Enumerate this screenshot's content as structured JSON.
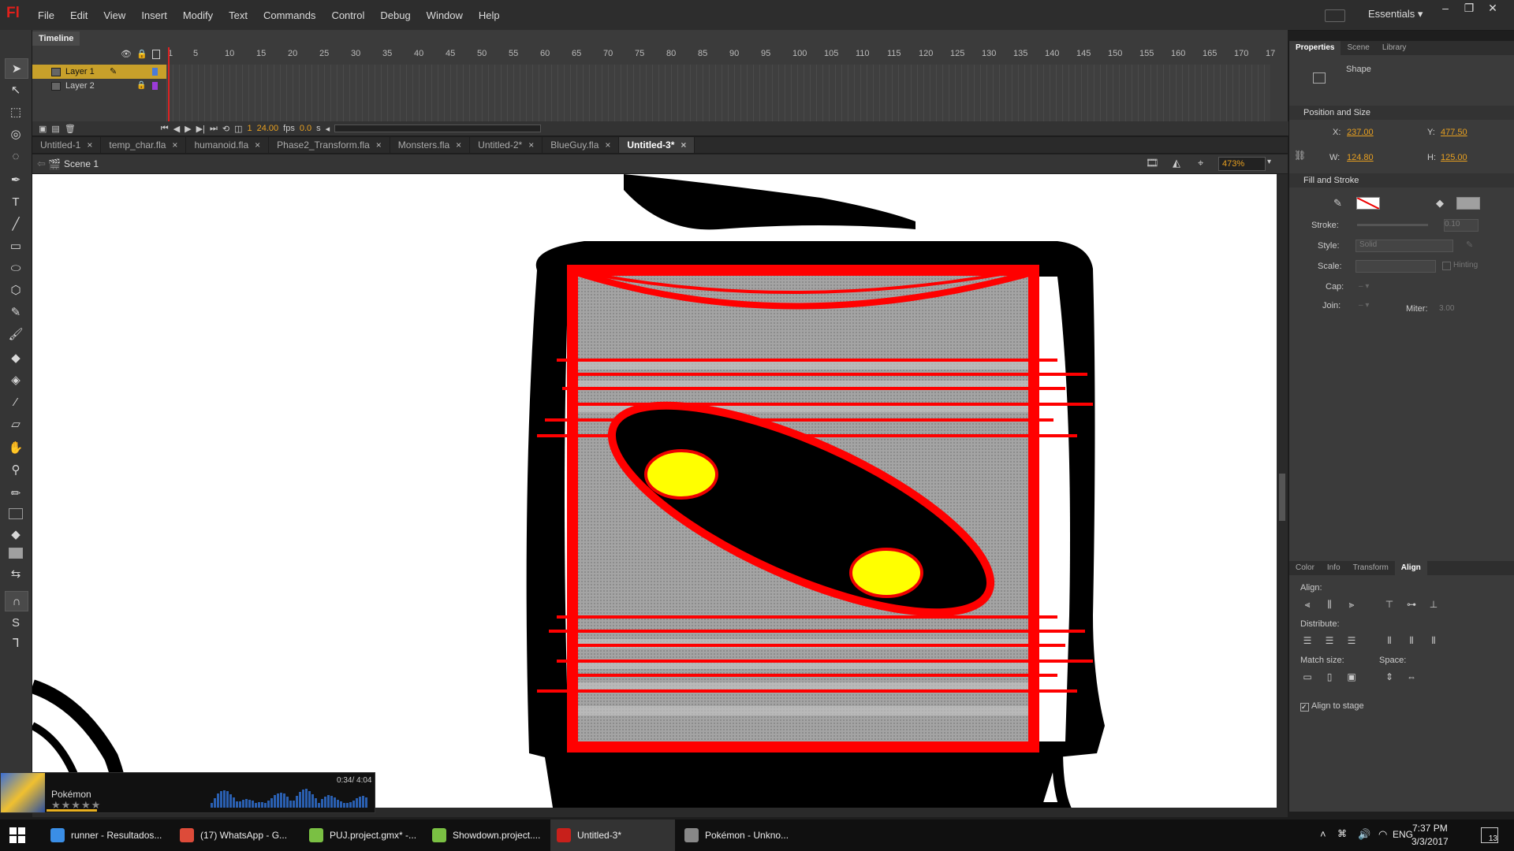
{
  "app": {
    "logo_text": "Fl",
    "menu": [
      "File",
      "Edit",
      "View",
      "Insert",
      "Modify",
      "Text",
      "Commands",
      "Control",
      "Debug",
      "Window",
      "Help"
    ],
    "workspace": "Essentials",
    "window_controls": [
      "minimize-icon",
      "restore-icon",
      "close-icon"
    ]
  },
  "timeline": {
    "tab": "Timeline",
    "ruler": [
      "1",
      "5",
      "10",
      "15",
      "20",
      "25",
      "30",
      "35",
      "40",
      "45",
      "50",
      "55",
      "60",
      "65",
      "70",
      "75",
      "80",
      "85",
      "90",
      "95",
      "100",
      "105",
      "110",
      "115",
      "120",
      "125",
      "130",
      "135",
      "140",
      "145",
      "150",
      "155",
      "160",
      "165",
      "170",
      "17"
    ],
    "layers": [
      {
        "name": "Layer 1",
        "color": "#4a7bd8",
        "selected": true
      },
      {
        "name": "Layer 2",
        "color": "#9b3bd8",
        "selected": false
      }
    ],
    "frame": "1",
    "fps": "24.00",
    "fps_unit": "fps",
    "time": "0.0",
    "time_unit": "s"
  },
  "doc_tabs": [
    {
      "label": "Untitled-1",
      "active": false
    },
    {
      "label": "temp_char.fla",
      "active": false
    },
    {
      "label": "humanoid.fla",
      "active": false
    },
    {
      "label": "Phase2_Transform.fla",
      "active": false
    },
    {
      "label": "Monsters.fla",
      "active": false
    },
    {
      "label": "Untitled-2*",
      "active": false
    },
    {
      "label": "BlueGuy.fla",
      "active": false
    },
    {
      "label": "Untitled-3*",
      "active": true
    }
  ],
  "editbar": {
    "scene": "Scene 1",
    "zoom": "473%"
  },
  "properties": {
    "tabs": [
      "Properties",
      "Scene",
      "Library"
    ],
    "object_type": "Shape",
    "position_size": {
      "header": "Position and Size",
      "x_label": "X:",
      "x": "237.00",
      "y_label": "Y:",
      "y": "477.50",
      "w_label": "W:",
      "w": "124.80",
      "h_label": "H:",
      "h": "125.00"
    },
    "fill_stroke": {
      "header": "Fill and Stroke",
      "stroke_label": "Stroke:",
      "stroke_value": "0.10",
      "style_label": "Style:",
      "style_value": "Solid",
      "scale_label": "Scale:",
      "hinting": "Hinting",
      "cap_label": "Cap:",
      "join_label": "Join:",
      "miter_label": "Miter:",
      "miter_value": "3.00",
      "fill_color": "#a0a0a0"
    }
  },
  "align_panel": {
    "tabs": [
      "Color",
      "Info",
      "Transform",
      "Align"
    ],
    "align_label": "Align:",
    "distribute_label": "Distribute:",
    "match_label": "Match size:",
    "space_label": "Space:",
    "align_to_stage": "Align to stage"
  },
  "music": {
    "title": "Pokémon",
    "time": "0:34/ 4:04",
    "rating": "★★★★★"
  },
  "taskbar": {
    "tasks": [
      {
        "label": "runner - Resultados...",
        "color": "#3a8ee6"
      },
      {
        "label": "(17) WhatsApp - G...",
        "color": "#dd4b39"
      },
      {
        "label": "PUJ.project.gmx* -...",
        "color": "#7ac043"
      },
      {
        "label": "Showdown.project....",
        "color": "#7ac043"
      },
      {
        "label": "Untitled-3*",
        "color": "#c8201b"
      },
      {
        "label": "Pokémon - Unkno...",
        "color": "#888888"
      }
    ],
    "lang": "ENG",
    "time": "7:37 PM",
    "date": "3/3/2017",
    "notifications": "13"
  }
}
